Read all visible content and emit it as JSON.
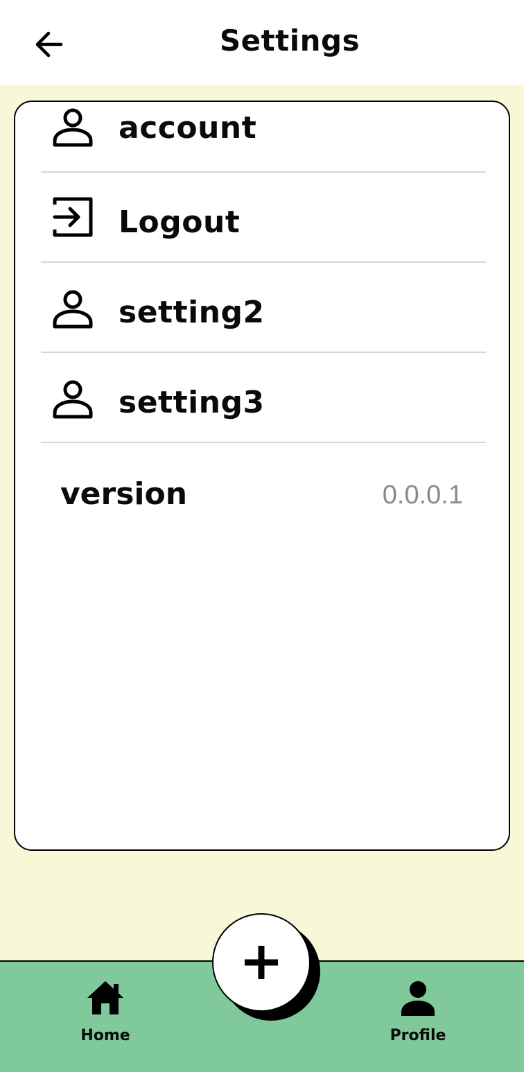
{
  "header": {
    "title": "Settings",
    "back_icon": "arrow-left-icon"
  },
  "settings": {
    "items": [
      {
        "label": "account",
        "icon": "person-outline-icon"
      },
      {
        "label": "Logout",
        "icon": "logout-icon"
      },
      {
        "label": "setting2",
        "icon": "person-outline-icon"
      },
      {
        "label": "setting3",
        "icon": "person-outline-icon"
      }
    ],
    "version": {
      "label": "version",
      "value": "0.0.0.1"
    }
  },
  "bottom_nav": {
    "items": [
      {
        "label": "Home",
        "icon": "home-icon"
      },
      {
        "label": "Profile",
        "icon": "person-icon"
      }
    ],
    "fab_icon": "plus-icon"
  },
  "colors": {
    "background": "#f8f8d9",
    "nav_background": "#80c99a",
    "card": "#ffffff",
    "version_value": "#8a8a8a"
  }
}
